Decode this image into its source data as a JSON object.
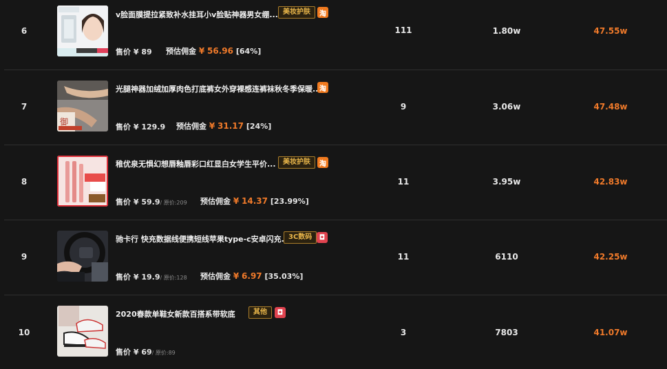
{
  "labels": {
    "price": "售价",
    "est_commission": "预估佣金",
    "currency": "¥",
    "original_prefix": "/ 原价:"
  },
  "colors": {
    "accent_orange": "#f07a2a",
    "tag_gold": "#e9b64a",
    "taobao": "#f07a1f",
    "pinduoduo": "#e0434f",
    "background": "#161616"
  },
  "rows": [
    {
      "rank": "6",
      "thumb_icon": "product-thumbnail-face-mask",
      "title": "v脸面膜提拉紧致补水挂耳小v脸贴神器男女绷...",
      "category_tag": "美妆护肤",
      "platform_icon": "taobao-icon",
      "platform_glyph": "淘",
      "price": "89",
      "original_price": "",
      "commission": "56.96",
      "commission_rate": "[64%]",
      "sales": "111",
      "views": "1.80w",
      "revenue": "47.55w"
    },
    {
      "rank": "7",
      "thumb_icon": "product-thumbnail-leggings",
      "title": "光腿神器加绒加厚肉色打底裤女外穿裸感连裤袜秋冬季保暖...",
      "category_tag": "",
      "platform_icon": "taobao-icon",
      "platform_glyph": "淘",
      "price": "129.9",
      "original_price": "",
      "commission": "31.17",
      "commission_rate": "[24%]",
      "sales": "9",
      "views": "3.06w",
      "revenue": "47.48w"
    },
    {
      "rank": "8",
      "thumb_icon": "product-thumbnail-lipstick",
      "title": "稚优泉无惧幻想唇釉唇彩口红显白女学生平价...",
      "category_tag": "美妆护肤",
      "platform_icon": "taobao-icon",
      "platform_glyph": "淘",
      "price": "59.9",
      "original_price": "209",
      "commission": "14.37",
      "commission_rate": "[23.99%]",
      "sales": "11",
      "views": "3.95w",
      "revenue": "42.83w"
    },
    {
      "rank": "9",
      "thumb_icon": "product-thumbnail-cable",
      "title": "驰卡行 快充数据线便携短线苹果type-c安卓闪充...",
      "category_tag": "3C数码",
      "platform_icon": "pinduoduo-icon",
      "platform_glyph": "◘",
      "price": "19.9",
      "original_price": "128",
      "commission": "6.97",
      "commission_rate": "[35.03%]",
      "sales": "11",
      "views": "6110",
      "revenue": "42.25w"
    },
    {
      "rank": "10",
      "thumb_icon": "product-thumbnail-shoes",
      "title": "2020春款单鞋女新款百搭系带软底",
      "category_tag": "其他",
      "platform_icon": "pinduoduo-icon",
      "platform_glyph": "◘",
      "price": "69",
      "original_price": "89",
      "commission": "",
      "commission_rate": "",
      "sales": "3",
      "views": "7803",
      "revenue": "41.07w"
    }
  ]
}
